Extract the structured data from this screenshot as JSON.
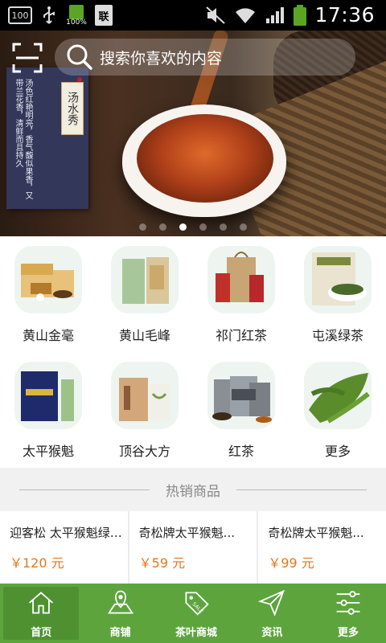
{
  "status_bar": {
    "left_box": "100",
    "battery_small_pct": "100%",
    "doc_icon_char": "联",
    "time": "17:36"
  },
  "banner": {
    "poster_text": "汤色红艳明亮，香气馥似果香，又带兰花香，清鲜而且持久",
    "poster_seal": "汤水秀",
    "page_count": 6,
    "active_page": 3
  },
  "search": {
    "placeholder": "搜索你喜欢的内容"
  },
  "categories": [
    {
      "label": "黄山金毫",
      "icon": "golden-gift-box"
    },
    {
      "label": "黄山毛峰",
      "icon": "green-tea-box"
    },
    {
      "label": "祁门红茶",
      "icon": "red-tea-bag"
    },
    {
      "label": "屯溪绿茶",
      "icon": "tea-can-bowl"
    },
    {
      "label": "太平猴魁",
      "icon": "blue-tin"
    },
    {
      "label": "顶谷大方",
      "icon": "paper-box"
    },
    {
      "label": "红茶",
      "icon": "silver-tins"
    },
    {
      "label": "更多",
      "icon": "tea-leaves"
    }
  ],
  "hot": {
    "title": "热销商品"
  },
  "products": [
    {
      "name": "迎客松 太平猴魁绿茶 ...",
      "price": "￥120 元"
    },
    {
      "name": "奇松牌太平猴魁...",
      "price": "￥59 元"
    },
    {
      "name": "奇松牌太平猴魁...",
      "price": "￥99 元"
    }
  ],
  "tabs": [
    {
      "label": "首页",
      "icon": "home-icon",
      "active": true
    },
    {
      "label": "商铺",
      "icon": "map-pin-icon",
      "active": false
    },
    {
      "label": "茶叶商城",
      "icon": "sale-tag-icon",
      "active": false
    },
    {
      "label": "资讯",
      "icon": "paper-plane-icon",
      "active": false
    },
    {
      "label": "更多",
      "icon": "sliders-icon",
      "active": false
    }
  ],
  "colors": {
    "accent_green": "#5da43d",
    "price_orange": "#e8751a"
  }
}
